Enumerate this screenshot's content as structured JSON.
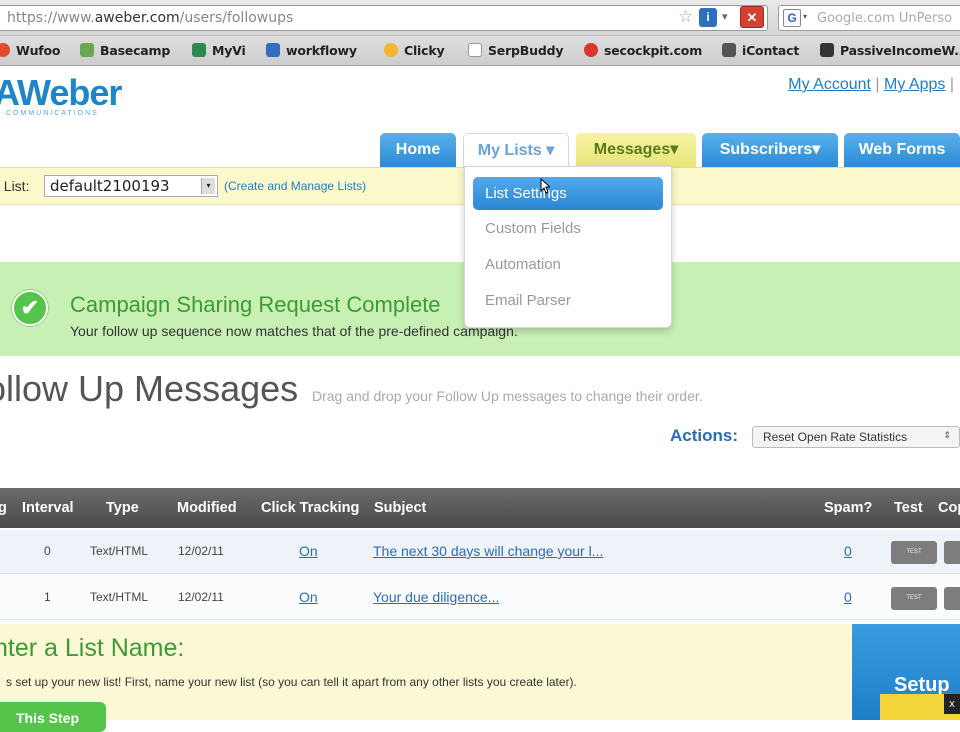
{
  "browser": {
    "url_scheme": "https://www.",
    "url_host": "aweber.com",
    "url_path": "/users/followups",
    "search_placeholder": "Google.com UnPerso",
    "google_glyph": "G",
    "star_glyph": "☆",
    "secure_glyph": "i",
    "stop_glyph": "✕",
    "drop_glyph": "▾"
  },
  "bookmarks": [
    {
      "label": "Wufoo",
      "color": "#e04a2f"
    },
    {
      "label": "Basecamp",
      "color": "#6aa84f"
    },
    {
      "label": "MyVi",
      "color": "#2d8a4e"
    },
    {
      "label": "workflowy",
      "color": "#2f6fbf"
    },
    {
      "label": "Clicky",
      "color": "#f2b632"
    },
    {
      "label": "SerpBuddy",
      "color": "#ffffff"
    },
    {
      "label": "secockpit.com",
      "color": "#d9362c"
    },
    {
      "label": "iContact",
      "color": "#555555"
    },
    {
      "label": "PassiveIncomeW...",
      "color": "#333333"
    }
  ],
  "brand": {
    "logo": "AWeber",
    "logo_sub": "COMMUNICATIONS"
  },
  "toplinks": {
    "my_account": "My Account",
    "my_apps": "My Apps",
    "separator": "|"
  },
  "nav": {
    "home": "Home",
    "my_lists": "My Lists",
    "messages": "Messages",
    "subscribers": "Subscribers",
    "web_forms": "Web Forms",
    "caret": "▾"
  },
  "list_bar": {
    "label": "t List:",
    "selected_list": "default2100193",
    "manage_link": "(Create and Manage Lists)",
    "arrow": "▾"
  },
  "dropdown": {
    "items": [
      "List Settings",
      "Custom Fields",
      "Automation",
      "Email Parser"
    ]
  },
  "success": {
    "icon": "✔",
    "title": "Campaign Sharing Request Complete",
    "body": "Your follow up sequence now matches that of the pre-defined campaign."
  },
  "main": {
    "title": "ollow Up Messages",
    "hint": "Drag and drop your Follow Up messages to change their order.",
    "actions_label": "Actions:",
    "actions_value": "Reset Open Rate Statistics",
    "actions_arrow": "⇕"
  },
  "table": {
    "headers": [
      "g",
      "Interval",
      "Type",
      "Modified",
      "Click Tracking",
      "Subject",
      "Spam?",
      "Test",
      "Cop"
    ],
    "test_label": "TEST",
    "rows": [
      {
        "interval": "0",
        "type": "Text/HTML",
        "modified": "12/02/11",
        "tracking": "On",
        "subject": "The next 30 days will change your l...",
        "spam": "0"
      },
      {
        "interval": "1",
        "type": "Text/HTML",
        "modified": "12/02/11",
        "tracking": "On",
        "subject": "Your due diligence...",
        "spam": "0"
      }
    ]
  },
  "new_list": {
    "title": "nter a List Name:",
    "body": "s set up your new list! First, name your new list (so you can tell it apart from any other lists you create later).",
    "next_button": "This Step",
    "setup": "Setup",
    "close": "x"
  }
}
